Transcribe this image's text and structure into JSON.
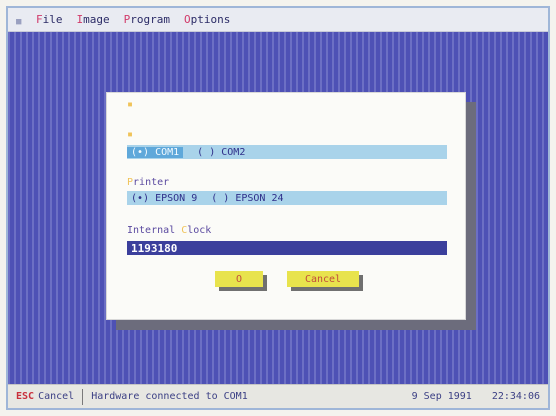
{
  "menu": {
    "items": [
      {
        "hot": "F",
        "rest": "ile"
      },
      {
        "hot": "I",
        "rest": "mage"
      },
      {
        "hot": "P",
        "rest": "rogram"
      },
      {
        "hot": "O",
        "rest": "ptions"
      }
    ]
  },
  "dialog": {
    "port": {
      "options": [
        {
          "text": "(•) COM1",
          "selected": true
        },
        {
          "text": "( ) COM2",
          "selected": false
        }
      ]
    },
    "printer": {
      "label_hot": "P",
      "label_rest": "rinter",
      "options": [
        {
          "text": "(•) EPSON 9"
        },
        {
          "text": "( ) EPSON 24"
        }
      ]
    },
    "clock": {
      "label_a": "Internal ",
      "label_hot": "C",
      "label_b": "lock",
      "value": "1193180"
    },
    "buttons": {
      "ok": "O",
      "cancel": "Cancel"
    }
  },
  "status": {
    "key": "ESC",
    "cancel": "Cancel",
    "message": "Hardware connected to COM1",
    "date": "9 Sep 1991",
    "time": "22:34:06"
  },
  "colors": {
    "desktop_stripe_light": "#6c6fc4",
    "desktop_stripe_dark": "#4e51b5",
    "button_yellow": "#e8e34d",
    "option_bar": "#a9d3ea",
    "input_bg": "#3b3f9c"
  }
}
